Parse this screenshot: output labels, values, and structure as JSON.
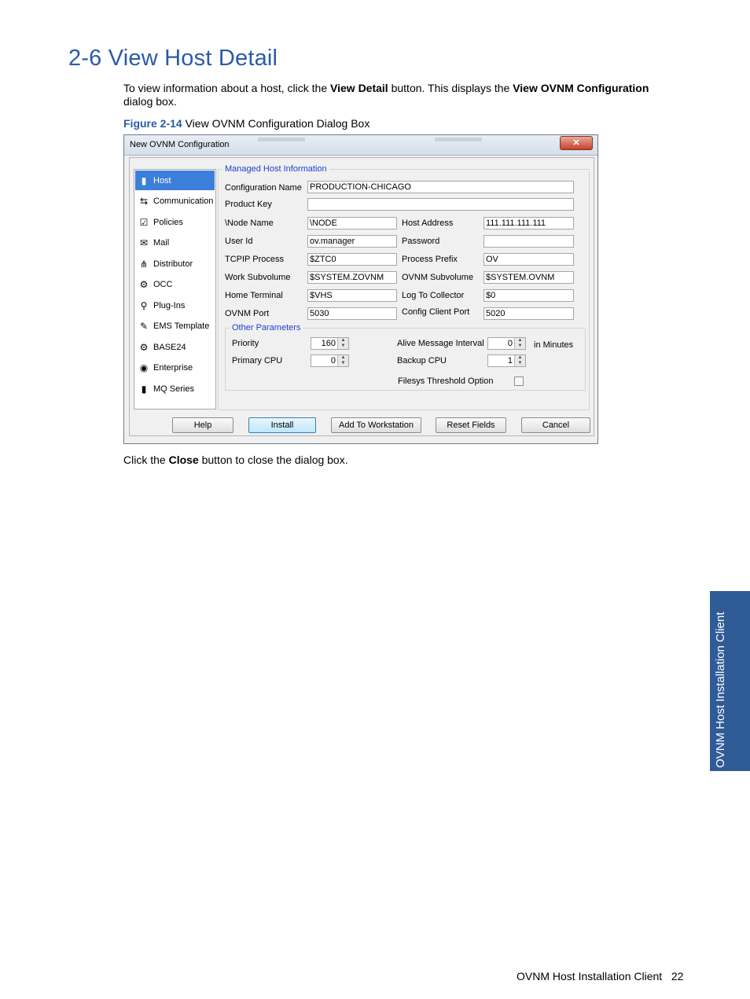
{
  "heading": "2-6 View Host Detail",
  "intro": {
    "p1": "To view information about a host, click the ",
    "b1": "View Detail",
    "p2": " button. This displays the ",
    "b2": "View OVNM Configuration",
    "p3": " dialog box."
  },
  "figure": {
    "number": "Figure 2-14",
    "caption": " View OVNM Configuration Dialog Box"
  },
  "dialog": {
    "title": "New OVNM Configuration",
    "close_glyph": "✕",
    "sidebar": [
      {
        "label": "Host",
        "icon": "server-icon",
        "glyph": "▮",
        "selected": true
      },
      {
        "label": "Communication",
        "icon": "network-icon",
        "glyph": "⇆"
      },
      {
        "label": "Policies",
        "icon": "checklist-icon",
        "glyph": "☑"
      },
      {
        "label": "Mail",
        "icon": "envelope-icon",
        "glyph": "✉"
      },
      {
        "label": "Distributor",
        "icon": "distributor-icon",
        "glyph": "⋔"
      },
      {
        "label": "OCC",
        "icon": "gears-icon",
        "glyph": "⚙"
      },
      {
        "label": "Plug-Ins",
        "icon": "plug-icon",
        "glyph": "⚲"
      },
      {
        "label": "EMS Template",
        "icon": "template-icon",
        "glyph": "✎"
      },
      {
        "label": "BASE24",
        "icon": "base24-icon",
        "glyph": "⚙"
      },
      {
        "label": "Enterprise",
        "icon": "globe-icon",
        "glyph": "◉"
      },
      {
        "label": "MQ Series",
        "icon": "server-icon",
        "glyph": "▮"
      }
    ],
    "managed": {
      "legend": "Managed Host Information",
      "config_name_label": "Configuration Name",
      "config_name": "PRODUCTION-CHICAGO",
      "product_key_label": "Product Key",
      "product_key": "",
      "node_name_label": "\\Node Name",
      "node_name": "\\NODE",
      "host_address_label": "Host Address",
      "host_address": "111.111.111.111",
      "user_id_label": "User Id",
      "user_id": "ov.manager",
      "password_label": "Password",
      "password": "",
      "tcpip_label": "TCPIP Process",
      "tcpip": "$ZTC0",
      "process_prefix_label": "Process Prefix",
      "process_prefix": "OV",
      "work_subvol_label": "Work Subvolume",
      "work_subvol": "$SYSTEM.ZOVNM",
      "ovnm_subvol_label": "OVNM Subvolume",
      "ovnm_subvol": "$SYSTEM.OVNM",
      "home_terminal_label": "Home Terminal",
      "home_terminal": "$VHS",
      "log_collector_label": "Log To Collector",
      "log_collector": "$0",
      "ovnm_port_label": "OVNM Port",
      "ovnm_port": "5030",
      "client_port_label": "Config Client Port",
      "client_port": "5020"
    },
    "other": {
      "legend": "Other Parameters",
      "priority_label": "Priority",
      "priority": "160",
      "alive_label": "Alive Message Interval",
      "alive": "0",
      "alive_unit": "in Minutes",
      "primary_cpu_label": "Primary CPU",
      "primary_cpu": "0",
      "backup_cpu_label": "Backup CPU",
      "backup_cpu": "1",
      "filesys_label": "Filesys Threshold Option"
    },
    "buttons": {
      "help": "Help",
      "install": "Install",
      "add": "Add To Workstation",
      "reset": "Reset Fields",
      "cancel": "Cancel"
    }
  },
  "after": {
    "p1": "Click the ",
    "b1": "Close",
    "p2": " button to close the dialog box."
  },
  "side_tab": "OVNM Host Installation Client",
  "footer": {
    "text": "OVNM Host Installation Client",
    "page": "22"
  }
}
